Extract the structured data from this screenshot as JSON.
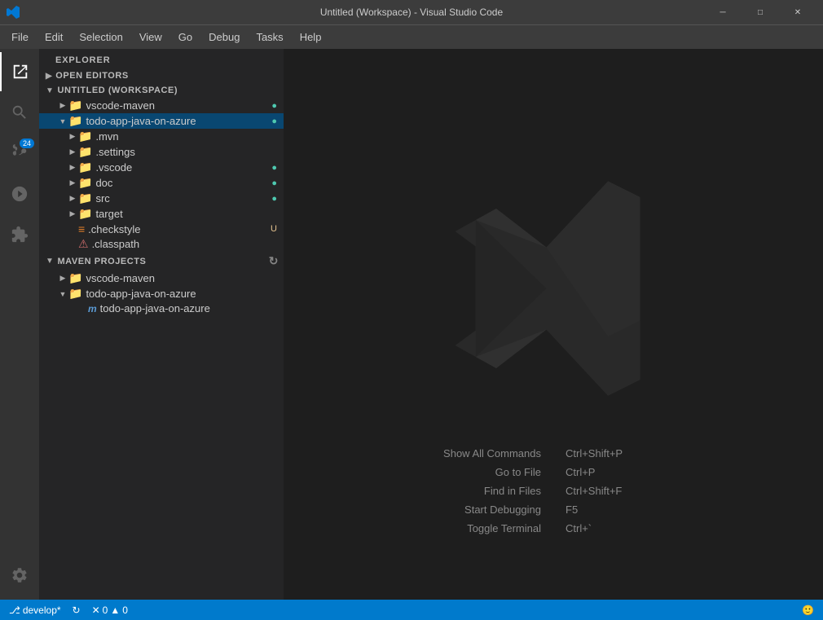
{
  "titleBar": {
    "title": "Untitled (Workspace) - Visual Studio Code",
    "minimize": "─",
    "maximize": "□",
    "close": "✕"
  },
  "menuBar": {
    "items": [
      "File",
      "Edit",
      "Selection",
      "View",
      "Go",
      "Debug",
      "Tasks",
      "Help"
    ]
  },
  "activityBar": {
    "icons": [
      {
        "name": "explorer-icon",
        "symbol": "⧉",
        "active": true,
        "label": "Explorer"
      },
      {
        "name": "search-icon",
        "symbol": "🔍",
        "active": false,
        "label": "Search"
      },
      {
        "name": "scm-icon",
        "symbol": "⎇",
        "active": false,
        "label": "Source Control",
        "badge": "24"
      },
      {
        "name": "debug-icon",
        "symbol": "🐛",
        "active": false,
        "label": "Debug"
      },
      {
        "name": "extensions-icon",
        "symbol": "⊞",
        "active": false,
        "label": "Extensions"
      }
    ],
    "bottomIcon": {
      "name": "settings-icon",
      "symbol": "⚙",
      "label": "Settings"
    }
  },
  "sidebar": {
    "header": "Explorer",
    "sections": [
      {
        "name": "open-editors",
        "label": "OPEN EDITORS",
        "collapsed": false
      },
      {
        "name": "workspace",
        "label": "UNTITLED (WORKSPACE)",
        "collapsed": false,
        "items": [
          {
            "indent": 2,
            "arrow": "▶",
            "icon": "📁",
            "label": "vscode-maven",
            "badge": "●",
            "badgeClass": "badge-green"
          },
          {
            "indent": 2,
            "arrow": "▼",
            "icon": "📁",
            "label": "todo-app-java-on-azure",
            "badge": "●",
            "badgeClass": "badge-green",
            "selected": true
          },
          {
            "indent": 3,
            "arrow": "▶",
            "icon": "📁",
            "label": ".mvn",
            "badge": "",
            "badgeClass": ""
          },
          {
            "indent": 3,
            "arrow": "▶",
            "icon": "📁",
            "label": ".settings",
            "badge": "",
            "badgeClass": ""
          },
          {
            "indent": 3,
            "arrow": "▶",
            "icon": "📁",
            "label": ".vscode",
            "badge": "●",
            "badgeClass": "badge-green"
          },
          {
            "indent": 3,
            "arrow": "▶",
            "icon": "📁",
            "label": "doc",
            "badge": "●",
            "badgeClass": "badge-green"
          },
          {
            "indent": 3,
            "arrow": "▶",
            "icon": "📁",
            "label": "src",
            "badge": "●",
            "badgeClass": "badge-green"
          },
          {
            "indent": 3,
            "arrow": "▶",
            "icon": "📁",
            "label": "target",
            "badge": "",
            "badgeClass": ""
          },
          {
            "indent": 3,
            "arrow": "",
            "icon": "≡",
            "label": ".checkstyle",
            "badge": "U",
            "badgeClass": "badge-yellow"
          },
          {
            "indent": 3,
            "arrow": "",
            "icon": "⚠",
            "label": ".classpath",
            "badge": "",
            "badgeClass": ""
          }
        ]
      },
      {
        "name": "maven-projects",
        "label": "MAVEN PROJECTS",
        "collapsed": false,
        "items": [
          {
            "indent": 2,
            "arrow": "▶",
            "icon": "📁",
            "label": "vscode-maven",
            "badge": "",
            "badgeClass": ""
          },
          {
            "indent": 2,
            "arrow": "▼",
            "icon": "📁",
            "label": "todo-app-java-on-azure",
            "badge": "",
            "badgeClass": ""
          },
          {
            "indent": 3,
            "arrow": "",
            "icon": "ⓜ",
            "label": "todo-app-java-on-azure",
            "badge": "",
            "badgeClass": ""
          }
        ]
      }
    ]
  },
  "editor": {
    "shortcuts": [
      {
        "label": "Show All Commands",
        "key": "Ctrl+Shift+P"
      },
      {
        "label": "Go to File",
        "key": "Ctrl+P"
      },
      {
        "label": "Find in Files",
        "key": "Ctrl+Shift+F"
      },
      {
        "label": "Start Debugging",
        "key": "F5"
      },
      {
        "label": "Toggle Terminal",
        "key": "Ctrl+`"
      }
    ]
  },
  "statusBar": {
    "branch": "develop*",
    "syncIcon": "↻",
    "errors": "0",
    "warnings": "0",
    "errorIcon": "✕",
    "warningIcon": "▲",
    "smiley": "🙂"
  }
}
